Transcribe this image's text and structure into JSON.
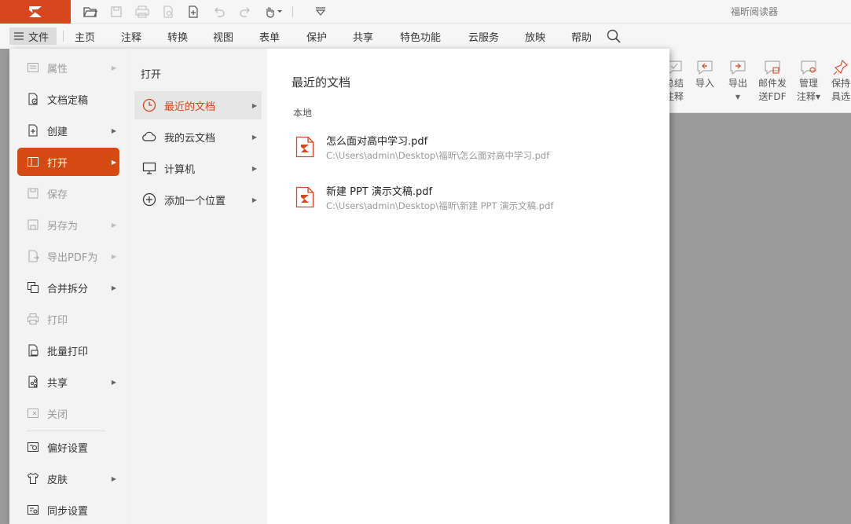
{
  "app_title": "福昕阅读器",
  "colors": {
    "brand": "#d7461e",
    "active_bg": "#d44a12",
    "active_text": "#d0471a"
  },
  "menubar": {
    "file_label": "文件",
    "items": [
      "主页",
      "注释",
      "转换",
      "视图",
      "表单",
      "保护",
      "共享",
      "特色功能",
      "云服务",
      "放映",
      "帮助"
    ]
  },
  "ribbon": {
    "items": [
      {
        "line1": "总结",
        "line2": "注释",
        "icon": "summarize-comments-icon"
      },
      {
        "line1": "导入",
        "line2": "",
        "icon": "import-icon"
      },
      {
        "line1": "导出",
        "line2": "▼",
        "icon": "export-icon"
      },
      {
        "line1": "邮件发",
        "line2": "送FDF",
        "icon": "email-fdf-icon"
      },
      {
        "line1": "管理",
        "line2": "注释▾",
        "icon": "manage-comments-icon"
      },
      {
        "line1": "保持",
        "line2": "具选",
        "icon": "keep-tool-icon"
      }
    ]
  },
  "file_menu": {
    "items": [
      {
        "label": "属性",
        "icon": "properties-icon",
        "disabled": true,
        "arrow": true
      },
      {
        "label": "文档定稿",
        "icon": "finalize-doc-icon",
        "disabled": false,
        "arrow": false
      },
      {
        "label": "创建",
        "icon": "create-icon",
        "disabled": false,
        "arrow": true
      },
      {
        "label": "打开",
        "icon": "open-icon",
        "disabled": false,
        "arrow": true,
        "active": true
      },
      {
        "label": "保存",
        "icon": "save-icon",
        "disabled": true,
        "arrow": false
      },
      {
        "label": "另存为",
        "icon": "save-as-icon",
        "disabled": true,
        "arrow": true
      },
      {
        "label": "导出PDF为",
        "icon": "export-pdf-icon",
        "disabled": true,
        "arrow": true
      },
      {
        "label": "合并拆分",
        "icon": "merge-split-icon",
        "disabled": false,
        "arrow": true
      },
      {
        "label": "打印",
        "icon": "print-icon",
        "disabled": true,
        "arrow": false
      },
      {
        "label": "批量打印",
        "icon": "batch-print-icon",
        "disabled": false,
        "arrow": false
      },
      {
        "label": "共享",
        "icon": "share-icon",
        "disabled": false,
        "arrow": true
      },
      {
        "label": "关闭",
        "icon": "close-doc-icon",
        "disabled": true,
        "arrow": false
      },
      {
        "label": "偏好设置",
        "icon": "preferences-icon",
        "disabled": false,
        "arrow": false
      },
      {
        "label": "皮肤",
        "icon": "skin-icon",
        "disabled": false,
        "arrow": true
      },
      {
        "label": "同步设置",
        "icon": "sync-settings-icon",
        "disabled": false,
        "arrow": false
      }
    ]
  },
  "open_menu": {
    "heading": "打开",
    "items": [
      {
        "label": "最近的文档",
        "icon": "clock-icon",
        "active": true
      },
      {
        "label": "我的云文档",
        "icon": "cloud-icon",
        "active": false
      },
      {
        "label": "计算机",
        "icon": "computer-icon",
        "active": false
      },
      {
        "label": "添加一个位置",
        "icon": "add-location-icon",
        "active": false
      }
    ]
  },
  "recent": {
    "title": "最近的文档",
    "section": "本地",
    "docs": [
      {
        "name": "怎么面对高中学习.pdf",
        "path": "C:\\Users\\admin\\Desktop\\福昕\\怎么面对高中学习.pdf"
      },
      {
        "name": "新建 PPT 演示文稿.pdf",
        "path": "C:\\Users\\admin\\Desktop\\福昕\\新建 PPT 演示文稿.pdf"
      }
    ]
  }
}
